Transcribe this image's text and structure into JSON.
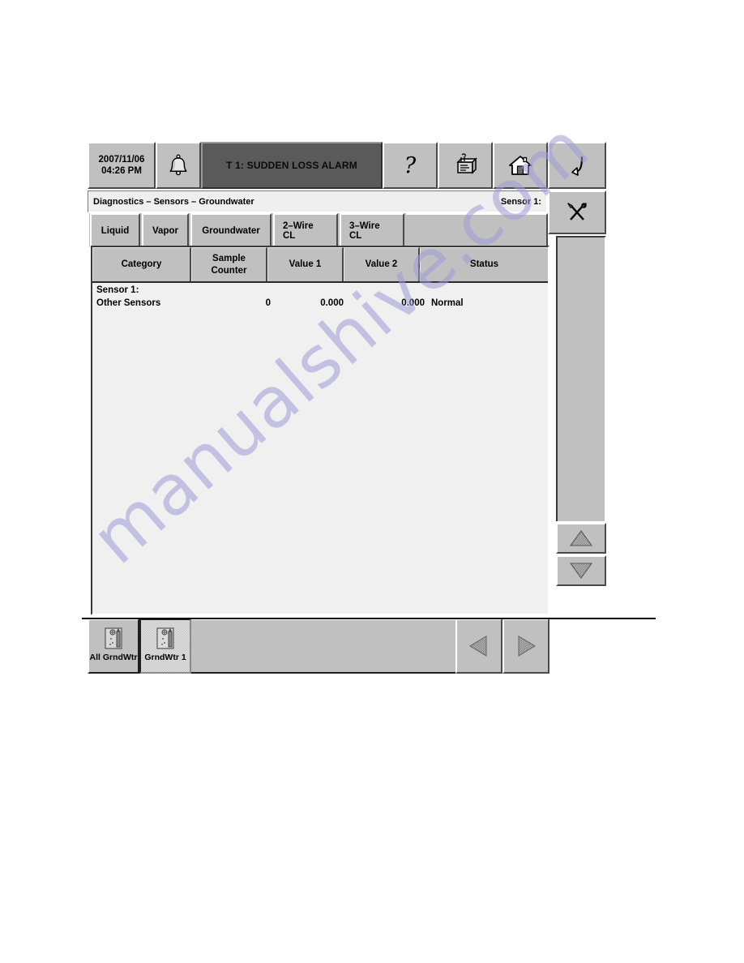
{
  "watermark": {
    "text": "manualshive.com",
    "color": "#9e9cd8"
  },
  "topbar": {
    "datetime": {
      "date": "2007/11/06",
      "time": "04:26 PM"
    },
    "alarm_bell_icon": "bell-icon",
    "alarm_banner": "T 1: SUDDEN LOSS ALARM",
    "help_icon": "question-mark-icon",
    "print_icon": "printer-icon",
    "home_icon": "home-icon",
    "back_icon": "return-arrow-icon",
    "tools_icon": "tools-icon"
  },
  "breadcrumb": {
    "path": "Diagnostics  –  Sensors  –  Groundwater",
    "right_label": "Sensor 1:"
  },
  "tabs": [
    {
      "label": "Liquid"
    },
    {
      "label": "Vapor"
    },
    {
      "label": "Groundwater"
    },
    {
      "label": "2–Wire CL"
    },
    {
      "label": "3–Wire CL"
    }
  ],
  "table": {
    "columns": [
      "Category",
      "Sample\nCounter",
      "Value 1",
      "Value 2",
      "Status"
    ],
    "column_headers": [
      {
        "label": "Category"
      },
      {
        "label_line1": "Sample",
        "label_line2": "Counter"
      },
      {
        "label": "Value 1"
      },
      {
        "label": "Value 2"
      },
      {
        "label": "Status"
      }
    ],
    "group_label": "Sensor 1:",
    "rows": [
      {
        "category": "Other Sensors",
        "sample_counter": "0",
        "value1": "0.000",
        "value2": "0.000",
        "status": "Normal"
      }
    ]
  },
  "right_rail": {
    "scroll_up_icon": "triangle-up-icon",
    "scroll_down_icon": "triangle-down-icon"
  },
  "bottom_bar": {
    "device_tabs": [
      {
        "label": "All GrndWtr",
        "icon": "groundwater-sensor-icon",
        "selected": false
      },
      {
        "label": "GrndWtr 1",
        "icon": "groundwater-sensor-icon",
        "selected": true
      }
    ],
    "prev_icon": "triangle-left-icon",
    "next_icon": "triangle-right-icon"
  },
  "colors": {
    "panel_face": "#c0c0c0",
    "content_bg": "#f0f0f0",
    "alarm_banner_bg": "#5a5a5a",
    "watermark": "#9e9cd8"
  }
}
